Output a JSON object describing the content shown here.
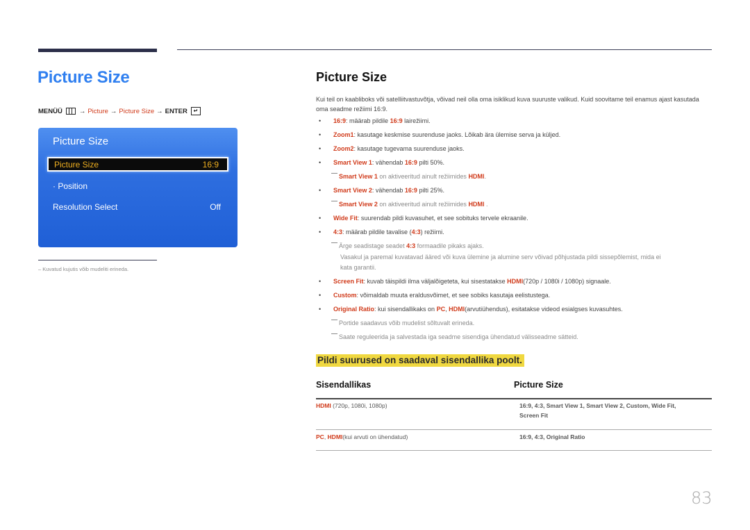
{
  "left": {
    "title": "Picture Size",
    "breadcrumb": {
      "menu": "MENÜÜ",
      "menu_icon": "menu-grid-icon",
      "arrow": "→",
      "picture": "Picture",
      "picture_size": "Picture Size",
      "enter": "ENTER",
      "enter_icon": "enter-icon"
    },
    "osd": {
      "title": "Picture Size",
      "selected": {
        "label": "Picture Size",
        "value": "16:9"
      },
      "position": "· Position",
      "resolution": {
        "label": "Resolution Select",
        "value": "Off"
      }
    },
    "footnote": "–  Kuvatud kujutis võib mudeliti erineda."
  },
  "right": {
    "title": "Picture Size",
    "intro": "Kui teil on kaabliboks või satelliitvastuvõtja, võivad neil olla oma isiklikud kuva suuruste valikud. Kuid soovitame teil enamus ajast kasutada oma seadme režiimi 16:9.",
    "items": [
      {
        "term": "16:9",
        "t1": ": määrab pildile ",
        "r1": "16:9",
        "t2": " lairežiimi."
      },
      {
        "term": "Zoom1",
        "t1": ": kasutage keskmise suurenduse jaoks. Lõikab ära ülemise serva ja küljed."
      },
      {
        "term": "Zoom2",
        "t1": ": kasutage tugevama suurenduse jaoks."
      },
      {
        "term": "Smart View 1",
        "t1": ": vähendab ",
        "r1": "16:9",
        "t2": " pilti 50%."
      },
      {
        "note": true,
        "r0": "Smart View 1",
        "t1": " on aktiveeritud ainult režiimides ",
        "r1": "HDMI",
        "t2": "."
      },
      {
        "term": "Smart View 2",
        "t1": ": vähendab ",
        "r1": "16:9",
        "t2": " pilti 25%."
      },
      {
        "note": true,
        "r0": "Smart View 2",
        "t1": " on aktiveeritud ainult režiimides ",
        "r1": "HDMI",
        "t2": " ."
      },
      {
        "term": "Wide Fit",
        "t1": ": suurendab pildi kuvasuhet, et see sobituks tervele ekraanile."
      },
      {
        "term": "4:3",
        "t1": ": määrab pildile tavalise (",
        "r1": "4:3",
        "t2": ") režiimi."
      },
      {
        "note": true,
        "t0": "Ärge seadistage seadet ",
        "r1": "4:3",
        "t2": " formaadile pikaks ajaks."
      },
      {
        "note_cont": "Vasakul ja paremal kuvatavad ääred või kuva ülemine ja alumine serv võivad põhjustada pildi sissepõlemist, mida ei"
      },
      {
        "note_cont": "kata garantii."
      },
      {
        "term": "Screen Fit",
        "t1": ": kuvab täispildi ilma väljalõigeteta, kui sisestatakse ",
        "r1": "HDMI",
        "t2": "(720p / 1080i / 1080p) signaale."
      },
      {
        "term": "Custom",
        "t1": ": võimaldab muuta eraldusvõimet, et see sobiks kasutaja eelistustega."
      },
      {
        "term": "Original Ratio",
        "t1": ": kui sisendallikaks on ",
        "r1": "PC",
        "t2": ", ",
        "r2": "HDMI",
        "t3": "(arvutiühendus), esitatakse videod esialgses kuvasuhtes."
      },
      {
        "note": true,
        "t0": "Portide saadavus võib mudelist sõltuvalt erineda."
      },
      {
        "note": true,
        "t0": "Saate reguleerida ja salvestada iga seadme sisendiga ühendatud välisseadme sätteid."
      }
    ],
    "section_heading": "Pildi suurused on saadaval sisendallika poolt.",
    "table": {
      "headers": [
        "Sisendallikas",
        "Picture Size"
      ],
      "rows": [
        {
          "source_red": "HDMI",
          "source_rest": " (720p, 1080i, 1080p)",
          "sizes_line1": "16:9, 4:3, Smart View 1, Smart View 2, Custom, Wide Fit,",
          "sizes_line2": "Screen Fit"
        },
        {
          "source_red": "PC",
          "source_sep": ", ",
          "source_red2": "HDMI",
          "source_rest": "(kui arvuti on ühendatud)",
          "sizes_line1": "16:9, 4:3, Original Ratio"
        }
      ]
    }
  },
  "page_number": "83",
  "colors": {
    "accent_blue": "#2f7ff0",
    "red": "#d03a1a",
    "highlight": "#f0d840",
    "osd_selected_text": "#f0b020"
  }
}
